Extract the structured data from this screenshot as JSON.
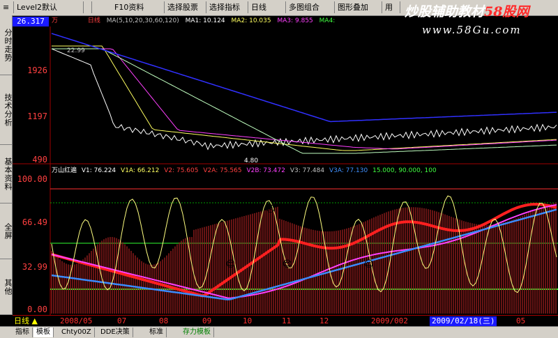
{
  "toolbar": {
    "level2": "Level2默认",
    "f10": "F10资料",
    "select_stock": "选择股票",
    "select_indicator": "选择指标",
    "period": "日线",
    "multi": "多图组合",
    "overlay": "图形叠加",
    "use": "用"
  },
  "watermark": {
    "brand_left": "炒股辅助教材",
    "brand_right": "58股网",
    "url": "www.58Gu.com"
  },
  "leftnav": [
    "分时走势",
    "技术分析",
    "基本资料",
    "全屏",
    "其他"
  ],
  "price_panel": {
    "current_price": "26.317",
    "stock_marker": "万",
    "period_label": "日线",
    "ma_header": "MA(5,10,20,30,60,120)",
    "ma1": "MA1: 10.124",
    "ma2": "MA2: 10.035",
    "ma3": "MA3: 9.855",
    "ma4": "MA4:",
    "high_label": "22.99",
    "low_label": "4.80",
    "axis": [
      "1926",
      "1197",
      "490"
    ]
  },
  "indicator_panel": {
    "name": "万山红遍",
    "v1": "V1: 76.224",
    "v1a": "V1A: 66.212",
    "v2": "V2: 75.605",
    "v2a": "V2A: 75.565",
    "v2b": "V2B: 73.472",
    "v3": "V3: 77.484",
    "v3a": "V3A: 77.130",
    "levels": "15.000, 90.000, 100",
    "axis": [
      "100.00",
      "66.49",
      "32.99",
      "0.00"
    ]
  },
  "dates": {
    "period": "日线",
    "ticks": [
      "2008/05",
      "07",
      "08",
      "09",
      "10",
      "11",
      "12",
      "2009/002",
      "05"
    ],
    "selected": "2009/02/18(三)"
  },
  "bottom_tabs": [
    "指标",
    "模板",
    "Chty00Z",
    "DDE决策",
    "标准",
    "存力模板"
  ],
  "colors": {
    "red": "#ff2020",
    "magenta": "#ff40ff",
    "blue": "#3a8cff",
    "green": "#30ff30",
    "yellow": "#ffff80"
  }
}
